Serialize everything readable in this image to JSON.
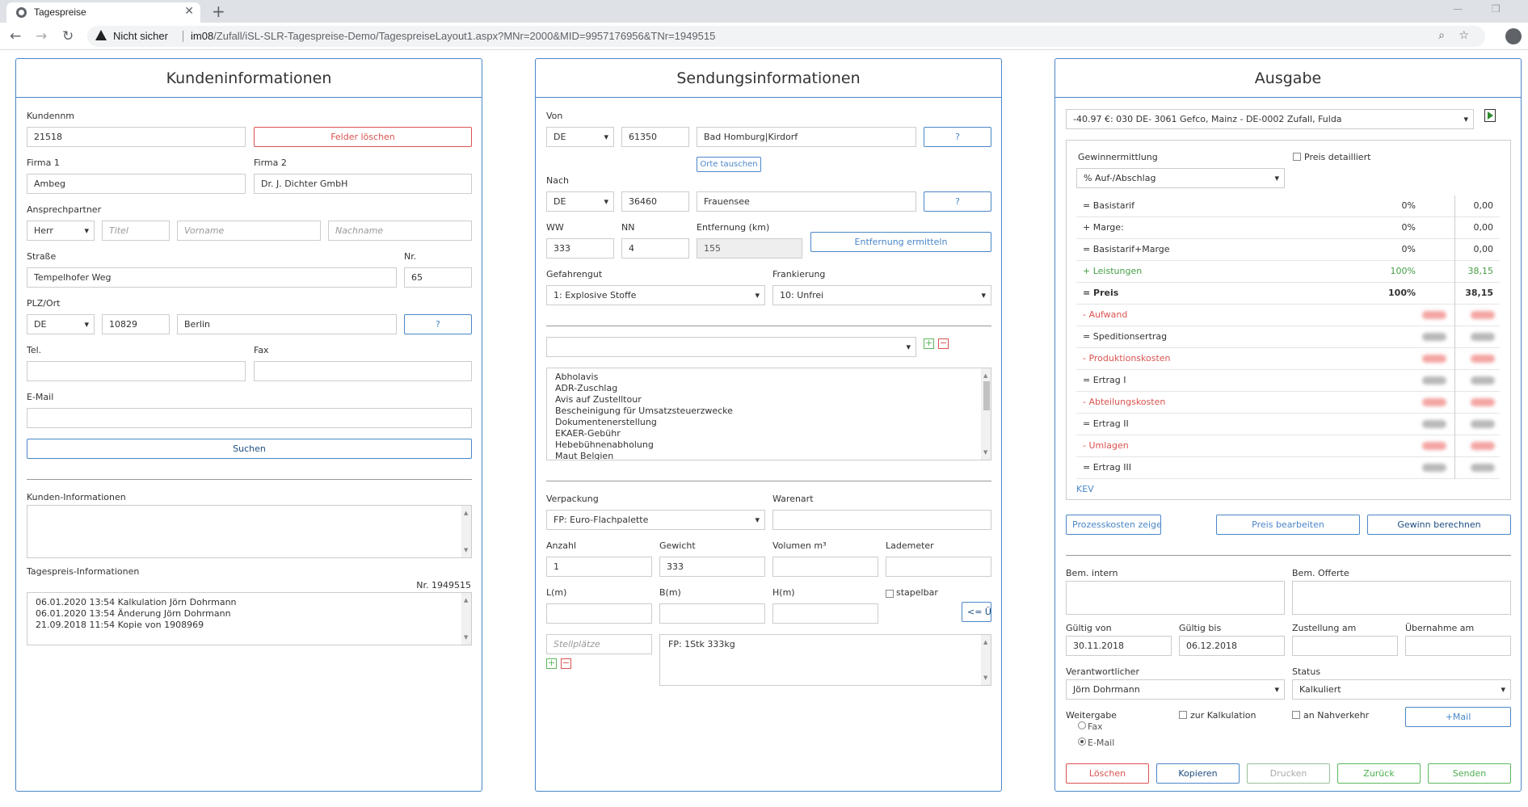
{
  "browser": {
    "tab_title": "Tagespreise",
    "security_label": "Nicht sicher",
    "url_host": "im08",
    "url_path": "/Zufall/iSL-SLR-Tagespreise-Demo/TagespreiseLayout1.aspx?MNr=2000&MID=9957176956&TNr=1949515"
  },
  "kunden": {
    "title": "Kundeninformationen",
    "kundennr_label": "Kundennm",
    "kundennr": "21518",
    "clear_button": "Felder löschen",
    "firma1_label": "Firma 1",
    "firma1": "Ambeg",
    "firma2_label": "Firma 2",
    "firma2": "Dr. J. Dichter GmbH",
    "ansprech_label": "Ansprechpartner",
    "anrede": "Herr",
    "titel_ph": "Titel",
    "vorname_ph": "Vorname",
    "nachname_ph": "Nachname",
    "strasse_label": "Straße",
    "strasse": "Tempelhofer Weg",
    "nr_label": "Nr.",
    "nr": "65",
    "plzort_label": "PLZ/Ort",
    "land": "DE",
    "plz": "10829",
    "ort": "Berlin",
    "help_button": "?",
    "tel_label": "Tel.",
    "fax_label": "Fax",
    "email_label": "E-Mail",
    "search_button": "Suchen",
    "info_label": "Kunden-Informationen",
    "tagespreis_label": "Tagespreis-Informationen",
    "tagespreis_nr": "Nr. 1949515",
    "log": [
      "06.01.2020 13:54 Kalkulation Jörn Dohrmann",
      "06.01.2020 13:54 Änderung Jörn Dohrmann",
      "21.09.2018 11:54 Kopie von 1908969"
    ]
  },
  "sendung": {
    "title": "Sendungsinformationen",
    "von_label": "Von",
    "von_land": "DE",
    "von_plz": "61350",
    "von_ort": "Bad Homburg|Kirdorf",
    "help_button": "?",
    "swap_button": "Orte tauschen",
    "nach_label": "Nach",
    "nach_land": "DE",
    "nach_plz": "36460",
    "nach_ort": "Frauensee",
    "ww_label": "WW",
    "ww": "333",
    "nn_label": "NN",
    "nn": "4",
    "entf_label": "Entfernung (km)",
    "entf": "155",
    "entf_button": "Entfernung ermitteln",
    "gefahr_label": "Gefahrengut",
    "gefahr": "1: Explosive Stoffe",
    "frank_label": "Frankierung",
    "frank": "10: Unfrei",
    "plus": "+",
    "minus": "−",
    "leistungen": [
      "Abholavis",
      "ADR-Zuschlag",
      "Avis auf Zustelltour",
      "Bescheinigung für Umsatzsteuerzwecke",
      "Dokumentenerstellung",
      "EKAER-Gebühr",
      "Hebebühnenabholung",
      "Maut Belgien"
    ],
    "verp_label": "Verpackung",
    "verp": "FP: Euro-Flachpalette",
    "warenart_label": "Warenart",
    "anzahl_label": "Anzahl",
    "anzahl": "1",
    "gewicht_label": "Gewicht",
    "gewicht": "333",
    "volumen_label": "Volumen m³",
    "lademeter_label": "Lademeter",
    "l_label": "L(m)",
    "b_label": "B(m)",
    "h_label": "H(m)",
    "stapelbar_label": "stapelbar",
    "back_button": "<= Ü",
    "stellplaetze_ph": "Stellplätze",
    "packstueck_text": "FP: 1Stk 333kg"
  },
  "ausgabe": {
    "title": "Ausgabe",
    "tarif": "-40.97 €: 030 DE- 3061 Gefco, Mainz - DE-0002 Zufall, Fulda",
    "gewinn_label": "Gewinnermittlung",
    "preis_detail_label": "Preis detailliert",
    "gewinn_mode": "% Auf-/Abschlag",
    "rows": [
      {
        "name": "= Basistarif",
        "pct": "0%",
        "val": "0,00",
        "style": "normal",
        "blur": false
      },
      {
        "name": "+ Marge:",
        "pct": "0%",
        "val": "0,00",
        "style": "normal",
        "blur": false
      },
      {
        "name": "= Basistarif+Marge",
        "pct": "0%",
        "val": "0,00",
        "style": "normal",
        "blur": false
      },
      {
        "name": "+ Leistungen",
        "pct": "100%",
        "val": "38,15",
        "style": "green",
        "blur": false
      },
      {
        "name": "= Preis",
        "pct": "100%",
        "val": "38,15",
        "style": "bold",
        "blur": false
      },
      {
        "name": "- Aufwand",
        "pct": "",
        "val": "",
        "style": "red",
        "blur": true
      },
      {
        "name": "= Speditionsertrag",
        "pct": "",
        "val": "",
        "style": "normal",
        "blur": true
      },
      {
        "name": "- Produktionskosten",
        "pct": "",
        "val": "",
        "style": "red",
        "blur": true
      },
      {
        "name": "= Ertrag I",
        "pct": "",
        "val": "",
        "style": "normal",
        "blur": true
      },
      {
        "name": "- Abteilungskosten",
        "pct": "",
        "val": "",
        "style": "red",
        "blur": true
      },
      {
        "name": "= Ertrag II",
        "pct": "",
        "val": "",
        "style": "normal",
        "blur": true
      },
      {
        "name": "- Umlagen",
        "pct": "",
        "val": "",
        "style": "red",
        "blur": true
      },
      {
        "name": "= Ertrag III",
        "pct": "",
        "val": "",
        "style": "normal",
        "blur": true
      }
    ],
    "kev_link": "KEV",
    "prozess_button": "Prozesskosten zeige",
    "preis_bearb_button": "Preis bearbeiten",
    "gewinn_button": "Gewinn berechnen",
    "bem_intern_label": "Bem. intern",
    "bem_offerte_label": "Bem. Offerte",
    "gueltig_von_label": "Gültig von",
    "gueltig_von": "30.11.2018",
    "gueltig_bis_label": "Gültig bis",
    "gueltig_bis": "06.12.2018",
    "zustellung_label": "Zustellung am",
    "uebernahme_label": "Übernahme am",
    "verantw_label": "Verantwortlicher",
    "verantw": "Jörn Dohrmann",
    "status_label": "Status",
    "status": "Kalkuliert",
    "weitergabe_label": "Weitergabe",
    "zur_kalk_label": "zur Kalkulation",
    "nahverkehr_label": "an Nahverkehr",
    "mail_button": "+Mail",
    "fax_label": "Fax",
    "email_label": "E-Mail",
    "loeschen_button": "Löschen",
    "kopieren_button": "Kopieren",
    "drucken_button": "Drucken",
    "zurueck_button": "Zurück",
    "senden_button": "Senden"
  }
}
